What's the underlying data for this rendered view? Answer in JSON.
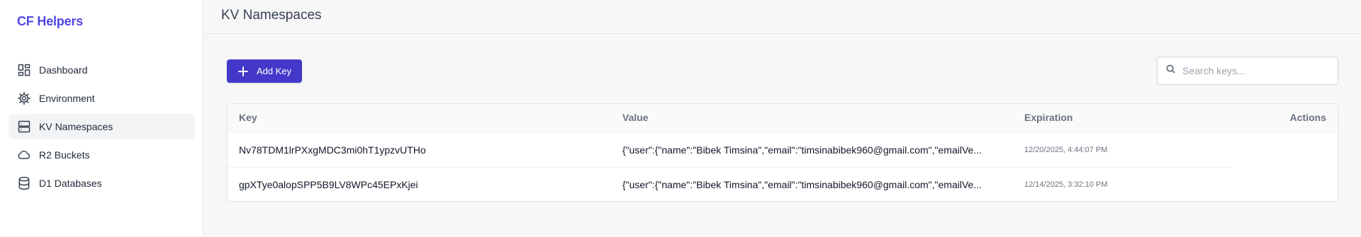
{
  "app": {
    "brand": "CF Helpers"
  },
  "sidebar": {
    "items": [
      {
        "label": "Dashboard",
        "icon": "dashboard-icon",
        "active": false
      },
      {
        "label": "Environment",
        "icon": "gear-icon",
        "active": false
      },
      {
        "label": "KV Namespaces",
        "icon": "server-icon",
        "active": true
      },
      {
        "label": "R2 Buckets",
        "icon": "cloud-icon",
        "active": false
      },
      {
        "label": "D1 Databases",
        "icon": "database-icon",
        "active": false
      }
    ]
  },
  "header": {
    "title": "KV Namespaces"
  },
  "toolbar": {
    "add_label": "Add Key",
    "add_icon": "plus-icon"
  },
  "search": {
    "placeholder": "Search keys...",
    "icon": "search-icon"
  },
  "table": {
    "columns": [
      "Key",
      "Value",
      "Expiration",
      "Actions"
    ],
    "rows": [
      {
        "key": "Nv78TDM1lrPXxgMDC3mi0hT1ypzvUTHo",
        "value": "{\"user\":{\"name\":\"Bibek Timsina\",\"email\":\"timsinabibek960@gmail.com\",\"emailVe...",
        "expiration": "12/20/2025, 4:44:07 PM"
      },
      {
        "key": "gpXTye0alopSPP5B9LV8WPc45EPxKjei",
        "value": "{\"user\":{\"name\":\"Bibek Timsina\",\"email\":\"timsinabibek960@gmail.com\",\"emailVe...",
        "expiration": "12/14/2025, 3:32:10 PM"
      }
    ]
  },
  "colors": {
    "accent": "#4338ca",
    "brand": "#4f46e5"
  }
}
